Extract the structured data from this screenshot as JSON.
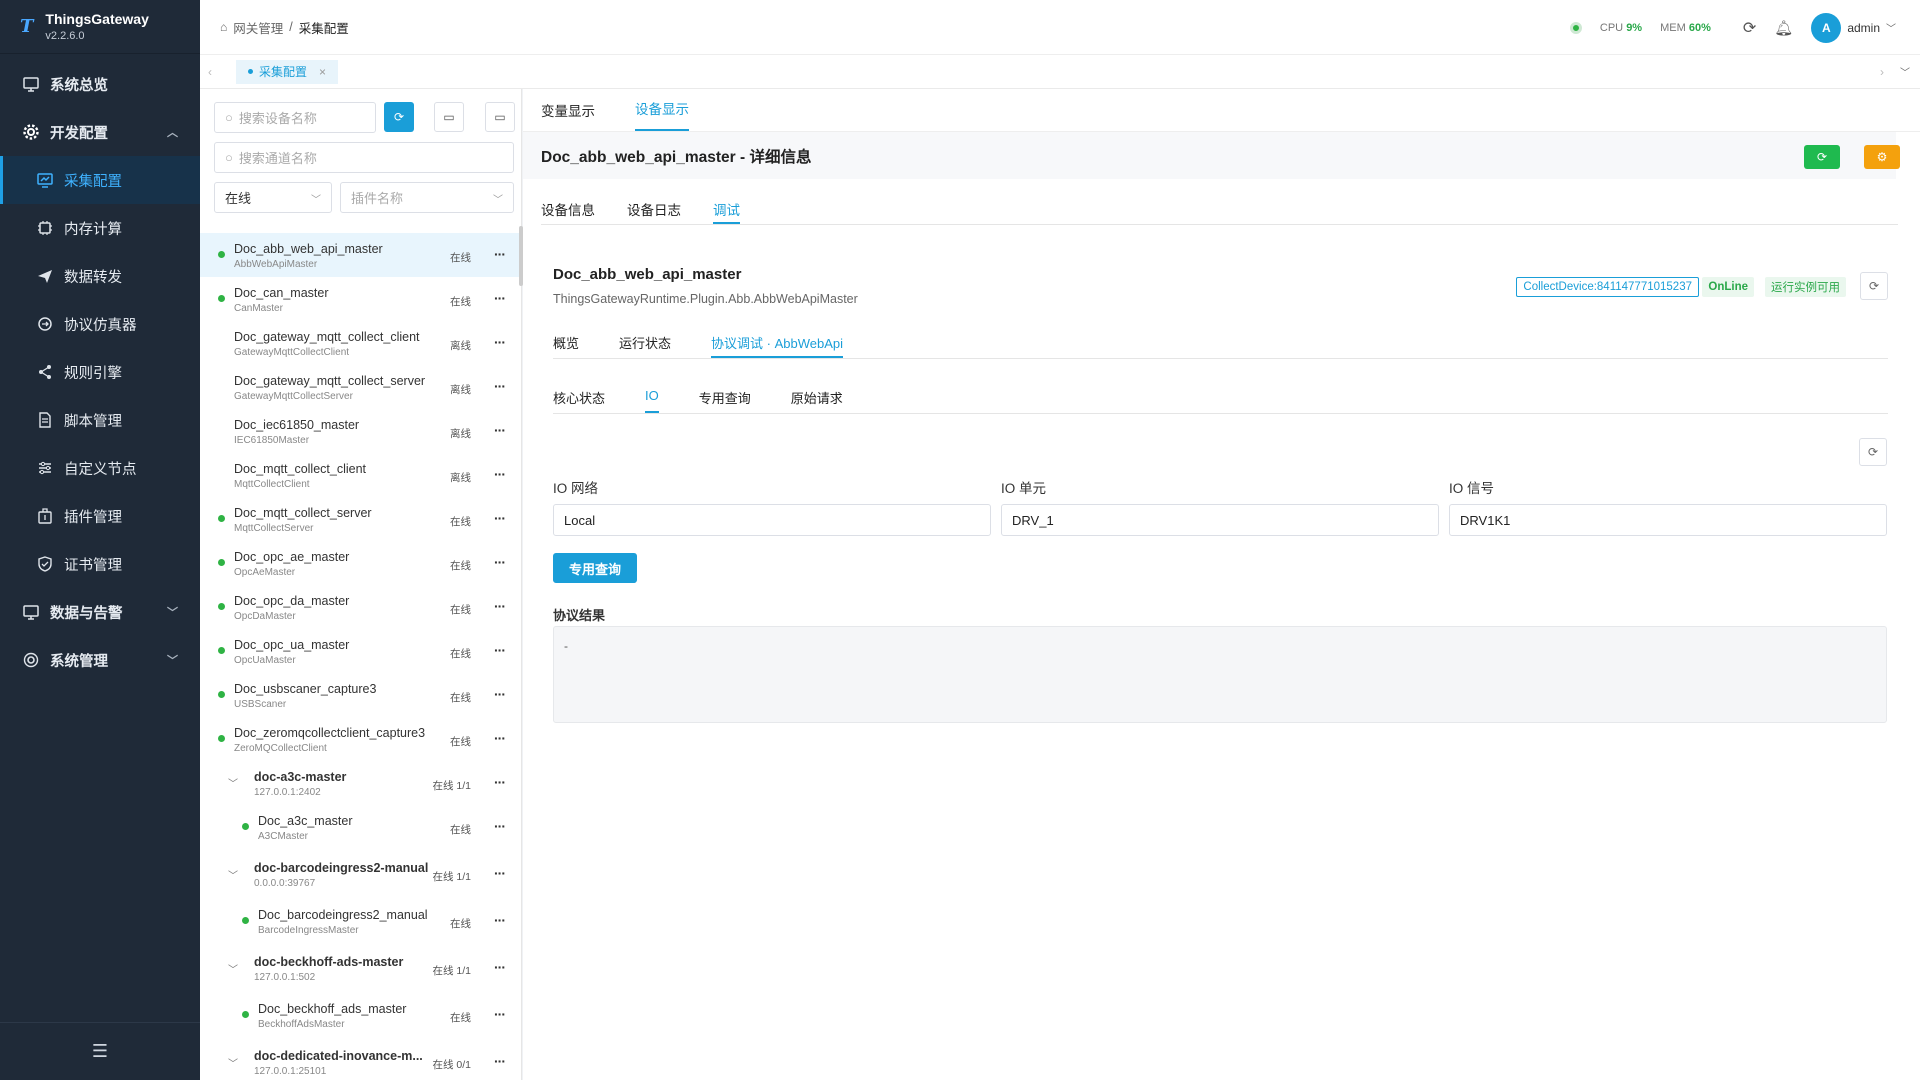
{
  "app": {
    "name": "ThingsGateway",
    "version": "v2.2.6.0"
  },
  "colors": {
    "accent": "#1a9ed8",
    "online": "#2fb344",
    "sidebar": "#1f2a38",
    "warn": "#f4a10d"
  },
  "sidebar": {
    "items": [
      {
        "label": "系统总览",
        "icon": "monitor-icon"
      },
      {
        "label": "开发配置",
        "icon": "gear-icon"
      },
      {
        "label": "采集配置",
        "icon": "chart-icon"
      },
      {
        "label": "内存计算",
        "icon": "chip-icon"
      },
      {
        "label": "数据转发",
        "icon": "send-icon"
      },
      {
        "label": "协议仿真器",
        "icon": "sync-icon"
      },
      {
        "label": "规则引擎",
        "icon": "share-icon"
      },
      {
        "label": "脚本管理",
        "icon": "file-icon"
      },
      {
        "label": "自定义节点",
        "icon": "sliders-icon"
      },
      {
        "label": "插件管理",
        "icon": "plugin-icon"
      },
      {
        "label": "证书管理",
        "icon": "certificate-icon"
      },
      {
        "label": "数据与告警",
        "icon": "alarm-icon"
      },
      {
        "label": "系统管理",
        "icon": "settings-icon"
      }
    ]
  },
  "header": {
    "breadcrumb": [
      "网关管理",
      "/",
      "采集配置"
    ],
    "cpu_label": "CPU",
    "cpu_value": "9%",
    "mem_label": "MEM",
    "mem_value": "60%",
    "user": "admin",
    "avatar": "A"
  },
  "tabs": {
    "active": "采集配置"
  },
  "left": {
    "search_device": "搜索设备名称",
    "search_channel": "搜索通道名称",
    "status_select": "在线",
    "plugin_select": "插件名称",
    "devices": [
      {
        "name": "Doc_abb_web_api_master",
        "plugin": "AbbWebApiMaster",
        "status": "在线",
        "online": true
      },
      {
        "name": "Doc_can_master",
        "plugin": "CanMaster",
        "status": "在线",
        "online": true
      },
      {
        "name": "Doc_gateway_mqtt_collect_client",
        "plugin": "GatewayMqttCollectClient",
        "status": "离线",
        "online": false
      },
      {
        "name": "Doc_gateway_mqtt_collect_server",
        "plugin": "GatewayMqttCollectServer",
        "status": "离线",
        "online": false
      },
      {
        "name": "Doc_iec61850_master",
        "plugin": "IEC61850Master",
        "status": "离线",
        "online": false
      },
      {
        "name": "Doc_mqtt_collect_client",
        "plugin": "MqttCollectClient",
        "status": "离线",
        "online": false
      },
      {
        "name": "Doc_mqtt_collect_server",
        "plugin": "MqttCollectServer",
        "status": "在线",
        "online": true
      },
      {
        "name": "Doc_opc_ae_master",
        "plugin": "OpcAeMaster",
        "status": "在线",
        "online": true
      },
      {
        "name": "Doc_opc_da_master",
        "plugin": "OpcDaMaster",
        "status": "在线",
        "online": true
      },
      {
        "name": "Doc_opc_ua_master",
        "plugin": "OpcUaMaster",
        "status": "在线",
        "online": true
      },
      {
        "name": "Doc_usbscaner_capture3",
        "plugin": "USBScaner",
        "status": "在线",
        "online": true
      },
      {
        "name": "Doc_zeromqcollectclient_capture3",
        "plugin": "ZeroMQCollectClient",
        "status": "在线",
        "online": true
      }
    ],
    "groups": [
      {
        "name": "doc-a3c-master",
        "addr": "127.0.0.1:2402",
        "status": "在线 1/1",
        "child": {
          "name": "Doc_a3c_master",
          "plugin": "A3CMaster",
          "status": "在线"
        }
      },
      {
        "name": "doc-barcodeingress2-manual",
        "addr": "0.0.0.0:39767",
        "status": "在线 1/1",
        "child": {
          "name": "Doc_barcodeingress2_manual",
          "plugin": "BarcodeIngressMaster",
          "status": "在线"
        }
      },
      {
        "name": "doc-beckhoff-ads-master",
        "addr": "127.0.0.1:502",
        "status": "在线 1/1",
        "child": {
          "name": "Doc_beckhoff_ads_master",
          "plugin": "BeckhoffAdsMaster",
          "status": "在线"
        }
      },
      {
        "name": "doc-dedicated-inovance-m...",
        "addr": "127.0.0.1:25101",
        "status": "在线 0/1"
      }
    ]
  },
  "right": {
    "top_tabs": [
      "变量显示",
      "设备显示"
    ],
    "detail_title": "Doc_abb_web_api_master - 详细信息",
    "tabs2": [
      "设备信息",
      "设备日志",
      "调试"
    ],
    "device_name": "Doc_abb_web_api_master",
    "device_class": "ThingsGatewayRuntime.Plugin.Abb.AbbWebApiMaster",
    "badges": {
      "id": "CollectDevice:841147771015237",
      "online": "OnLine",
      "runtime": "运行实例可用"
    },
    "tabs3": [
      "概览",
      "运行状态",
      "协议调试 · AbbWebApi"
    ],
    "tabs4": [
      "核心状态",
      "IO",
      "专用查询",
      "原始请求"
    ],
    "fields": {
      "network_label": "IO 网络",
      "network_value": "Local",
      "unit_label": "IO 单元",
      "unit_value": "DRV_1",
      "signal_label": "IO 信号",
      "signal_value": "DRV1K1"
    },
    "query_button": "专用查询",
    "result_label": "协议结果",
    "result_value": "-"
  }
}
